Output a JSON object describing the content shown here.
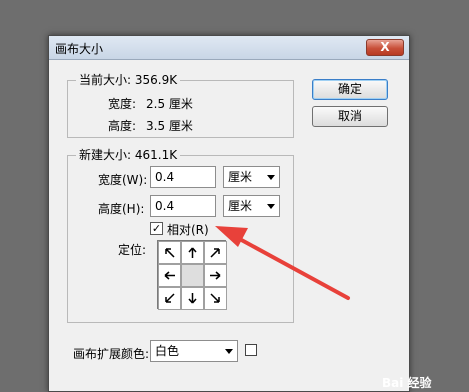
{
  "dialog": {
    "title": "画布大小",
    "close_label": "X"
  },
  "current_size": {
    "label": "当前大小: 356.9K",
    "width_label": "宽度:",
    "width_value": "2.5 厘米",
    "height_label": "高度:",
    "height_value": "3.5 厘米"
  },
  "new_size": {
    "label": "新建大小: 461.1K",
    "width_label": "宽度(W):",
    "width_value": "0.4",
    "width_unit": "厘米",
    "height_label": "高度(H):",
    "height_value": "0.4",
    "height_unit": "厘米",
    "relative_label": "相对(R)",
    "relative_checked": true,
    "anchor_label": "定位:"
  },
  "buttons": {
    "ok": "确定",
    "cancel": "取消"
  },
  "extension_color": {
    "label": "画布扩展颜色:",
    "value": "白色",
    "swatch_color": "#ffffff"
  },
  "annotation": {
    "arrow_color": "#e8413a"
  },
  "watermark": "Bai 经验",
  "icons": [
    "close-icon",
    "checkmark-icon",
    "anchor-arrows",
    "dropdown-arrow-icon"
  ]
}
